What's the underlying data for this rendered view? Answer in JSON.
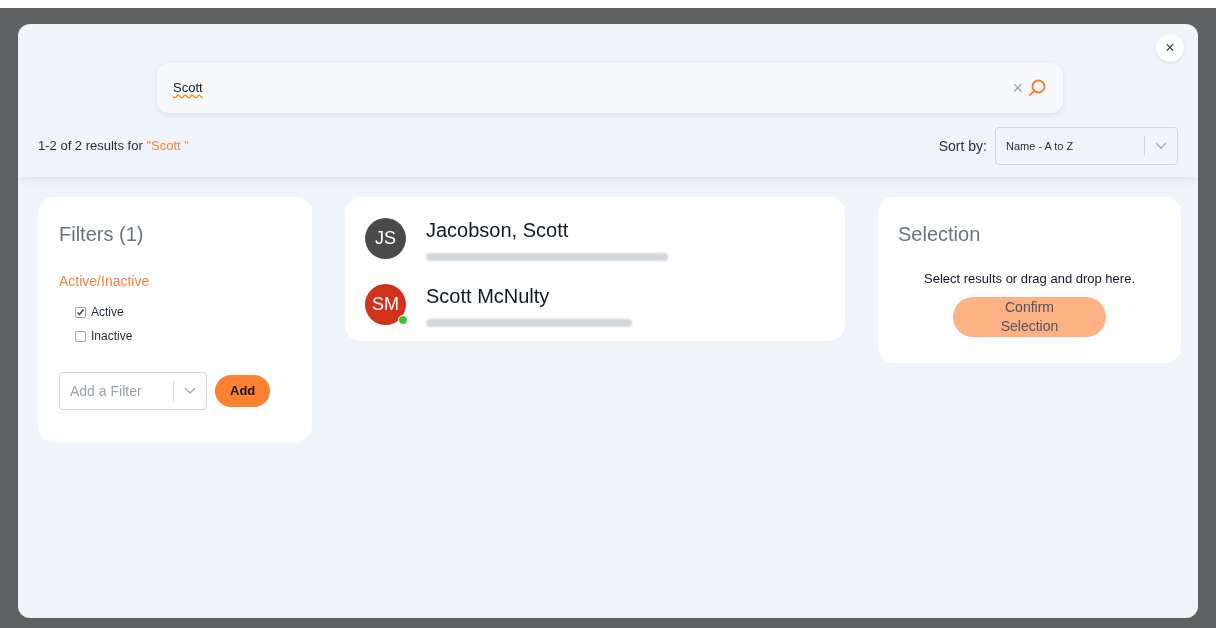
{
  "close_button": "×",
  "search": {
    "value": "Scott",
    "clear": "×"
  },
  "results_summary": {
    "prefix": "1-2 of 2 results for",
    "query": "\"Scott \""
  },
  "sort": {
    "label": "Sort by:",
    "value": "Name - A to Z"
  },
  "filters": {
    "title": "Filters (1)",
    "groups": [
      {
        "label": "Active/Inactive",
        "options": [
          {
            "label": "Active",
            "checked": true
          },
          {
            "label": "Inactive",
            "checked": false
          }
        ]
      }
    ],
    "add_filter": {
      "placeholder": "Add a Filter"
    },
    "add_button": "Add"
  },
  "results": [
    {
      "initials": "JS",
      "name": "Jacobson, Scott",
      "color": "#4a4a4a",
      "online": false
    },
    {
      "initials": "SM",
      "name": "Scott McNulty",
      "color": "#d0321a",
      "online": true
    }
  ],
  "selection": {
    "title": "Selection",
    "hint": "Select results or drag and drop here.",
    "confirm_button": {
      "label": "Confirm Selection",
      "disabled": true
    }
  }
}
